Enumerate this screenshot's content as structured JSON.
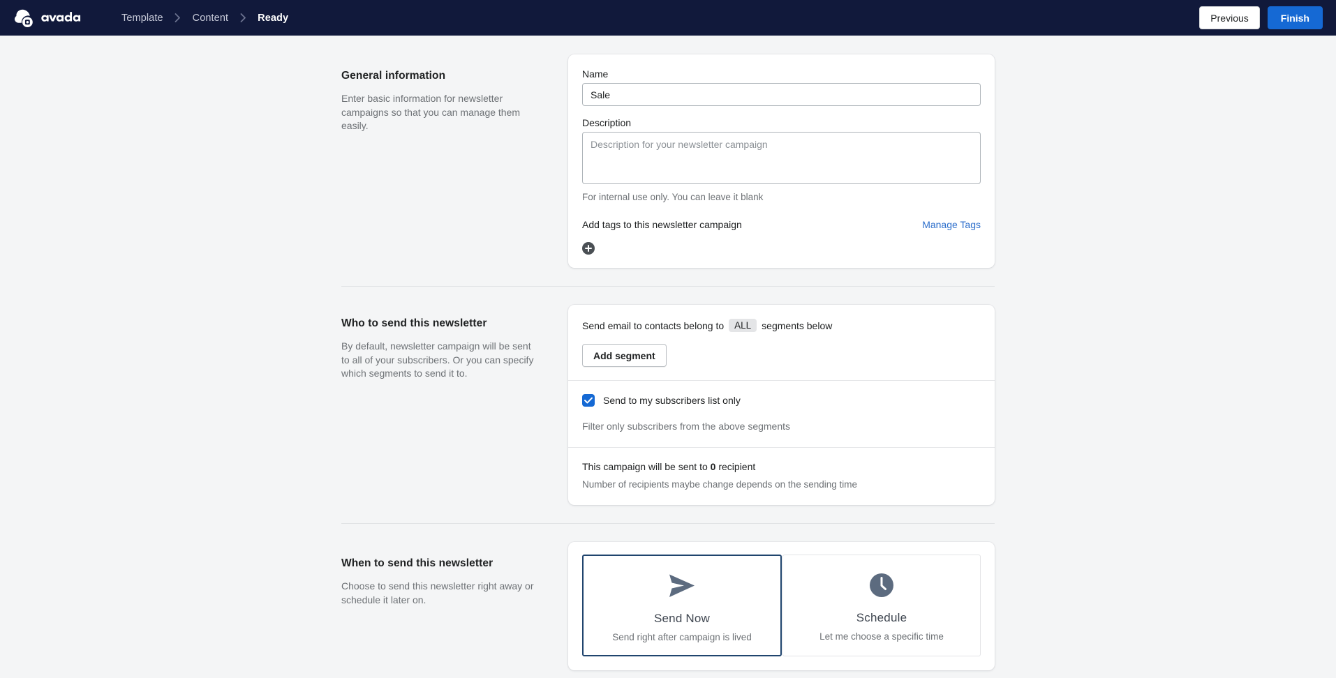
{
  "brand": {
    "name": "avada",
    "logo_icon": "avada-cloud-logo",
    "topbar_bg": "#11193b",
    "accent": "#1569d4"
  },
  "topbar": {
    "breadcrumb": [
      {
        "label": "Template",
        "active": false
      },
      {
        "label": "Content",
        "active": false
      },
      {
        "label": "Ready",
        "active": true
      }
    ],
    "separator_icon": "chevron-right-icon",
    "previous_label": "Previous",
    "finish_label": "Finish"
  },
  "sections": {
    "general": {
      "title": "General information",
      "description": "Enter basic information for newsletter campaigns so that you can manage them easily.",
      "name_label": "Name",
      "name_value": "Sale",
      "description_label": "Description",
      "description_placeholder": "Description for your newsletter campaign",
      "description_value": "",
      "description_help": "For internal use only. You can leave it blank",
      "tags_label": "Add tags to this newsletter campaign",
      "manage_tags_label": "Manage Tags",
      "add_tag_icon": "plus-circle-icon"
    },
    "who": {
      "title": "Who to send this newsletter",
      "description": "By default, newsletter campaign will be sent to all of your subscribers. Or you can specify which segments to send it to.",
      "send_line_prefix": "Send email to contacts belong to",
      "send_line_pill": "ALL",
      "send_line_suffix": "segments below",
      "add_segment_label": "Add segment",
      "subscribers_checkbox_label": "Send to my subscribers list only",
      "subscribers_checkbox_checked": true,
      "subscribers_note": "Filter only subscribers from the above segments",
      "recipient_prefix": "This campaign will be sent to",
      "recipient_count": "0",
      "recipient_suffix": "recipient",
      "recipient_note": "Number of recipients maybe change depends on the sending time"
    },
    "when": {
      "title": "When to send this newsletter",
      "description": "Choose to send this newsletter right away or schedule it later on.",
      "options": [
        {
          "icon": "paper-plane-icon",
          "title": "Send Now",
          "subtitle": "Send right after campaign is lived",
          "selected": true
        },
        {
          "icon": "clock-icon",
          "title": "Schedule",
          "subtitle": "Let me choose a specific time",
          "selected": false
        }
      ]
    }
  }
}
